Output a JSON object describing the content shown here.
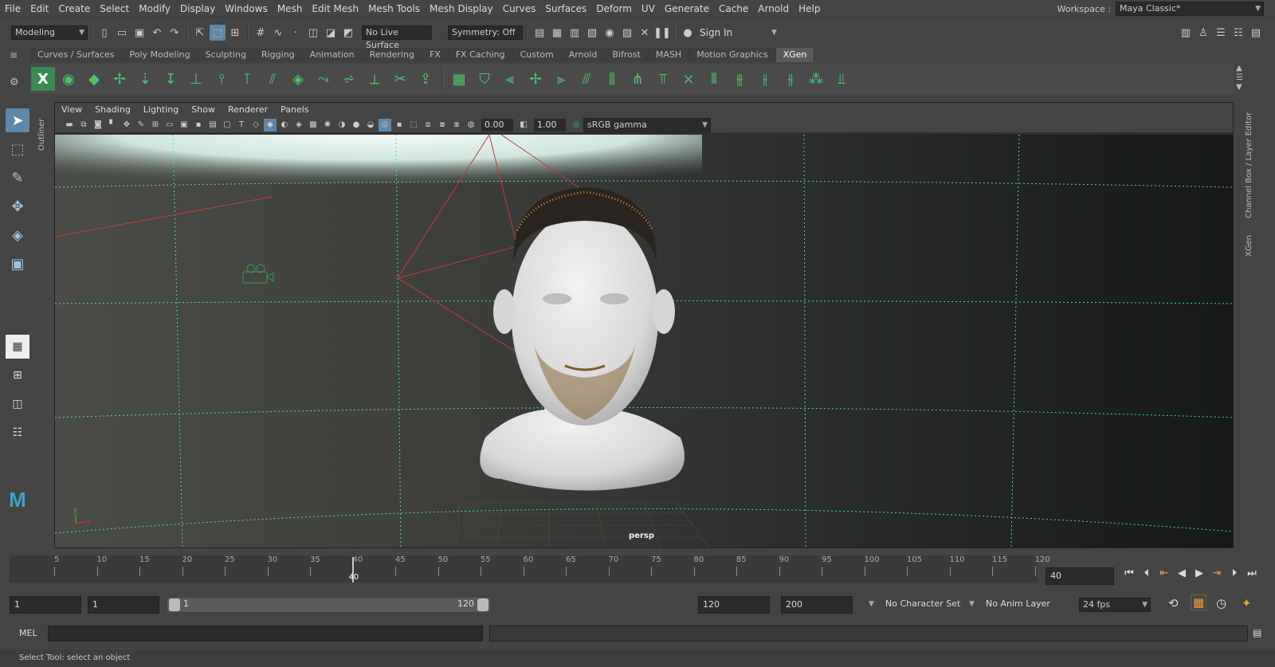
{
  "menubar": {
    "items": [
      "File",
      "Edit",
      "Create",
      "Select",
      "Modify",
      "Display",
      "Windows",
      "Mesh",
      "Edit Mesh",
      "Mesh Tools",
      "Mesh Display",
      "Curves",
      "Surfaces",
      "Deform",
      "UV",
      "Generate",
      "Cache",
      "Arnold",
      "Help"
    ],
    "workspace_label": "Workspace :",
    "workspace_value": "Maya Classic*"
  },
  "statusline": {
    "mode": "Modeling",
    "live_surface": "No Live Surface",
    "symmetry": "Symmetry: Off",
    "sign_in": "Sign In"
  },
  "shelf": {
    "tabs": [
      "Curves / Surfaces",
      "Poly Modeling",
      "Sculpting",
      "Rigging",
      "Animation",
      "Rendering",
      "FX",
      "FX Caching",
      "Custom",
      "Arnold",
      "Bifrost",
      "MASH",
      "Motion Graphics",
      "XGen"
    ],
    "selected_tab": "XGen"
  },
  "outliner_tab": "Outliner",
  "viewport": {
    "menus": [
      "View",
      "Shading",
      "Lighting",
      "Show",
      "Renderer",
      "Panels"
    ],
    "exposure": "0.00",
    "gamma": "1.00",
    "color_space": "sRGB gamma",
    "camera_label": "persp",
    "axis_y": "y",
    "axis_x": "x"
  },
  "rightdock": {
    "channel_box": "Channel Box / Layer Editor",
    "xgen": "XGen"
  },
  "timeslider": {
    "ticks": [
      "5",
      "10",
      "15",
      "20",
      "25",
      "30",
      "35",
      "40",
      "45",
      "50",
      "55",
      "60",
      "65",
      "70",
      "75",
      "80",
      "85",
      "90",
      "95",
      "100",
      "105",
      "110",
      "115",
      "120"
    ],
    "current_frame": "40",
    "current_label": "40",
    "current_fraction": 0.333
  },
  "range": {
    "start": "1",
    "anim_start": "1",
    "range_start_label": "1",
    "range_end_label": "120",
    "end": "120",
    "anim_end": "200",
    "character_set": "No Character Set",
    "anim_layer": "No Anim Layer",
    "fps": "24 fps"
  },
  "cmdline": {
    "lang": "MEL"
  },
  "help_line": "Select Tool: select an object"
}
